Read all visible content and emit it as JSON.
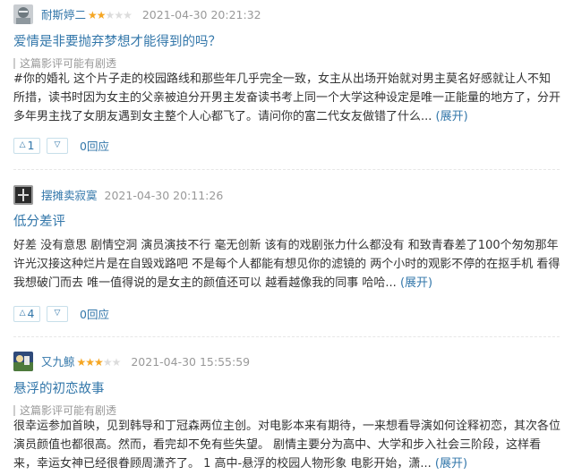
{
  "reviews": [
    {
      "author": "耐斯婷二",
      "rating": 2,
      "time": "2021-04-30 20:21:32",
      "title": "爱情是非要抛弃梦想才能得到的吗？",
      "spoiler": "这篇影评可能有剧透",
      "content": "#你的婚礼 这个片子走的校园路线和那些年几乎完全一致，女主从出场开始就对男主莫名好感就让人不知所措，读书时因为女主的父亲被迫分开男主发奋读书考上同一个大学这种设定是唯一正能量的地方了，分开多年男主找了女朋友遇到女主整个人心都飞了。请问你的富二代女友做错了什么...",
      "expand": "(展开)",
      "up": "1",
      "reply": "0回应",
      "avatar_colors": [
        "#6f7a80",
        "#c9cdd1"
      ]
    },
    {
      "author": "摆摊卖寂寞",
      "rating": 0,
      "time": "2021-04-30 20:11:26",
      "title": "低分差评",
      "spoiler": "",
      "content": "好差 没有意思 剧情空洞 演员演技不行 毫无创新 该有的戏剧张力什么都没有 和致青春差了100个匆匆那年 许光汉接这种烂片是在自毁戏路吧 不是每个人都能有想见你的滤镜的 两个小时的观影不停的在抠手机 看得我想破门而去 唯一值得说的是女主的颜值还可以 越看越像我的同事 哈哈...",
      "expand": "(展开)",
      "up": "4",
      "reply": "0回应",
      "avatar_colors": [
        "#2b2b2b",
        "#8a8a8a"
      ]
    },
    {
      "author": "又九鲸",
      "rating": 3,
      "time": "2021-04-30 15:55:59",
      "title": "悬浮的初恋故事",
      "spoiler": "这篇影评可能有剧透",
      "content": "很幸运参加首映，见到韩导和丁冠森两位主创。对电影本来有期待，一来想看导演如何诠释初恋，其次各位演员颜值也都很高。然而，看完却不免有些失望。 剧情主要分为高中、大学和步入社会三阶段，这样看来，幸运女神已经很眷顾周潇齐了。 1 高中-悬浮的校园人物形象 电影开始，潇...",
      "expand": "(展开)",
      "up": "",
      "reply": "",
      "avatar_colors": [
        "#4e7a3c",
        "#2f4a7a"
      ]
    }
  ],
  "colors": {
    "link": "#3377aa",
    "star": "#f5a623",
    "meta": "#999999"
  },
  "icons": {
    "up": "triangle-up-icon",
    "down": "triangle-down-icon"
  }
}
